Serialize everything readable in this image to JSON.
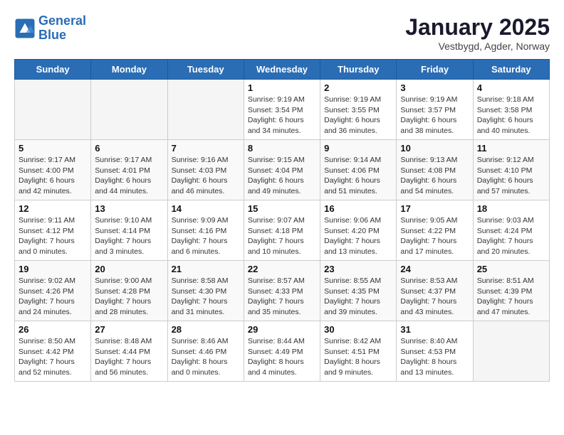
{
  "logo": {
    "line1": "General",
    "line2": "Blue"
  },
  "title": "January 2025",
  "subtitle": "Vestbygd, Agder, Norway",
  "days_of_week": [
    "Sunday",
    "Monday",
    "Tuesday",
    "Wednesday",
    "Thursday",
    "Friday",
    "Saturday"
  ],
  "weeks": [
    [
      {
        "day": "",
        "info": ""
      },
      {
        "day": "",
        "info": ""
      },
      {
        "day": "",
        "info": ""
      },
      {
        "day": "1",
        "info": "Sunrise: 9:19 AM\nSunset: 3:54 PM\nDaylight: 6 hours\nand 34 minutes."
      },
      {
        "day": "2",
        "info": "Sunrise: 9:19 AM\nSunset: 3:55 PM\nDaylight: 6 hours\nand 36 minutes."
      },
      {
        "day": "3",
        "info": "Sunrise: 9:19 AM\nSunset: 3:57 PM\nDaylight: 6 hours\nand 38 minutes."
      },
      {
        "day": "4",
        "info": "Sunrise: 9:18 AM\nSunset: 3:58 PM\nDaylight: 6 hours\nand 40 minutes."
      }
    ],
    [
      {
        "day": "5",
        "info": "Sunrise: 9:17 AM\nSunset: 4:00 PM\nDaylight: 6 hours\nand 42 minutes."
      },
      {
        "day": "6",
        "info": "Sunrise: 9:17 AM\nSunset: 4:01 PM\nDaylight: 6 hours\nand 44 minutes."
      },
      {
        "day": "7",
        "info": "Sunrise: 9:16 AM\nSunset: 4:03 PM\nDaylight: 6 hours\nand 46 minutes."
      },
      {
        "day": "8",
        "info": "Sunrise: 9:15 AM\nSunset: 4:04 PM\nDaylight: 6 hours\nand 49 minutes."
      },
      {
        "day": "9",
        "info": "Sunrise: 9:14 AM\nSunset: 4:06 PM\nDaylight: 6 hours\nand 51 minutes."
      },
      {
        "day": "10",
        "info": "Sunrise: 9:13 AM\nSunset: 4:08 PM\nDaylight: 6 hours\nand 54 minutes."
      },
      {
        "day": "11",
        "info": "Sunrise: 9:12 AM\nSunset: 4:10 PM\nDaylight: 6 hours\nand 57 minutes."
      }
    ],
    [
      {
        "day": "12",
        "info": "Sunrise: 9:11 AM\nSunset: 4:12 PM\nDaylight: 7 hours\nand 0 minutes."
      },
      {
        "day": "13",
        "info": "Sunrise: 9:10 AM\nSunset: 4:14 PM\nDaylight: 7 hours\nand 3 minutes."
      },
      {
        "day": "14",
        "info": "Sunrise: 9:09 AM\nSunset: 4:16 PM\nDaylight: 7 hours\nand 6 minutes."
      },
      {
        "day": "15",
        "info": "Sunrise: 9:07 AM\nSunset: 4:18 PM\nDaylight: 7 hours\nand 10 minutes."
      },
      {
        "day": "16",
        "info": "Sunrise: 9:06 AM\nSunset: 4:20 PM\nDaylight: 7 hours\nand 13 minutes."
      },
      {
        "day": "17",
        "info": "Sunrise: 9:05 AM\nSunset: 4:22 PM\nDaylight: 7 hours\nand 17 minutes."
      },
      {
        "day": "18",
        "info": "Sunrise: 9:03 AM\nSunset: 4:24 PM\nDaylight: 7 hours\nand 20 minutes."
      }
    ],
    [
      {
        "day": "19",
        "info": "Sunrise: 9:02 AM\nSunset: 4:26 PM\nDaylight: 7 hours\nand 24 minutes."
      },
      {
        "day": "20",
        "info": "Sunrise: 9:00 AM\nSunset: 4:28 PM\nDaylight: 7 hours\nand 28 minutes."
      },
      {
        "day": "21",
        "info": "Sunrise: 8:58 AM\nSunset: 4:30 PM\nDaylight: 7 hours\nand 31 minutes."
      },
      {
        "day": "22",
        "info": "Sunrise: 8:57 AM\nSunset: 4:33 PM\nDaylight: 7 hours\nand 35 minutes."
      },
      {
        "day": "23",
        "info": "Sunrise: 8:55 AM\nSunset: 4:35 PM\nDaylight: 7 hours\nand 39 minutes."
      },
      {
        "day": "24",
        "info": "Sunrise: 8:53 AM\nSunset: 4:37 PM\nDaylight: 7 hours\nand 43 minutes."
      },
      {
        "day": "25",
        "info": "Sunrise: 8:51 AM\nSunset: 4:39 PM\nDaylight: 7 hours\nand 47 minutes."
      }
    ],
    [
      {
        "day": "26",
        "info": "Sunrise: 8:50 AM\nSunset: 4:42 PM\nDaylight: 7 hours\nand 52 minutes."
      },
      {
        "day": "27",
        "info": "Sunrise: 8:48 AM\nSunset: 4:44 PM\nDaylight: 7 hours\nand 56 minutes."
      },
      {
        "day": "28",
        "info": "Sunrise: 8:46 AM\nSunset: 4:46 PM\nDaylight: 8 hours\nand 0 minutes."
      },
      {
        "day": "29",
        "info": "Sunrise: 8:44 AM\nSunset: 4:49 PM\nDaylight: 8 hours\nand 4 minutes."
      },
      {
        "day": "30",
        "info": "Sunrise: 8:42 AM\nSunset: 4:51 PM\nDaylight: 8 hours\nand 9 minutes."
      },
      {
        "day": "31",
        "info": "Sunrise: 8:40 AM\nSunset: 4:53 PM\nDaylight: 8 hours\nand 13 minutes."
      },
      {
        "day": "",
        "info": ""
      }
    ]
  ]
}
